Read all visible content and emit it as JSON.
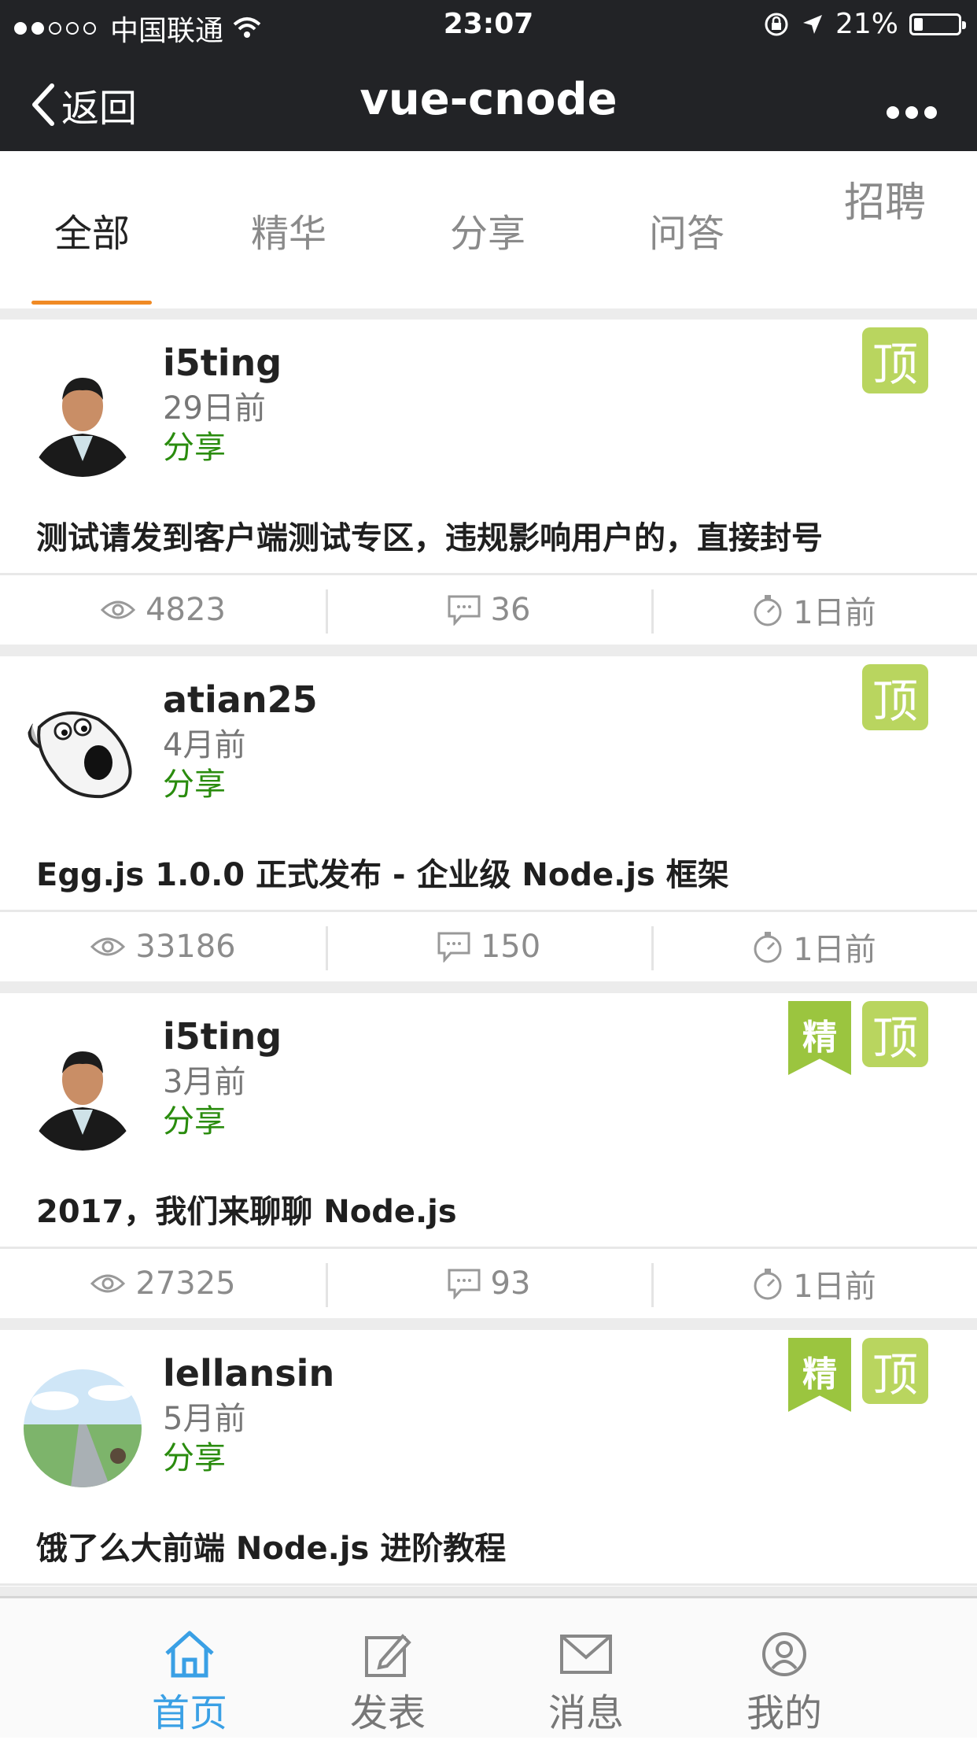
{
  "status_bar": {
    "carrier": "中国联通",
    "time": "23:07",
    "battery": "21%",
    "battery_level": 0.21
  },
  "nav": {
    "back_label": "返回",
    "title": "vue-cnode"
  },
  "tabs": [
    {
      "label": "全部"
    },
    {
      "label": "精华"
    },
    {
      "label": "分享"
    },
    {
      "label": "问答"
    },
    {
      "label": "招聘"
    }
  ],
  "posts": [
    {
      "author": "i5ting",
      "time": "29日前",
      "tab": "分享",
      "top_label": "顶",
      "good_label": "",
      "title": "测试请发到客户端测试专区，违规影响用户的，直接封号",
      "views": "4823",
      "replies": "36",
      "last_reply": "1日前"
    },
    {
      "author": "atian25",
      "time": "4月前",
      "tab": "分享",
      "top_label": "顶",
      "good_label": "",
      "title": "Egg.js 1.0.0 正式发布 - 企业级 Node.js 框架",
      "views": "33186",
      "replies": "150",
      "last_reply": "1日前"
    },
    {
      "author": "i5ting",
      "time": "3月前",
      "tab": "分享",
      "top_label": "顶",
      "good_label": "精",
      "title": "2017，我们来聊聊 Node.js",
      "views": "27325",
      "replies": "93",
      "last_reply": "1日前"
    },
    {
      "author": "lellansin",
      "time": "5月前",
      "tab": "分享",
      "top_label": "顶",
      "good_label": "精",
      "title": "饿了么大前端 Node.js 进阶教程",
      "views": "",
      "replies": "",
      "last_reply": ""
    }
  ],
  "bottom_tabs": [
    {
      "label": "首页",
      "icon": "home-icon"
    },
    {
      "label": "发表",
      "icon": "edit-icon"
    },
    {
      "label": "消息",
      "icon": "mail-icon"
    },
    {
      "label": "我的",
      "icon": "user-icon"
    }
  ],
  "colors": {
    "nav_bg": "#222326",
    "tab_indicator": "#f08a24",
    "tag_green": "#2a8c0e",
    "badge_green": "#b9d55f",
    "active_blue": "#3aa0e5"
  }
}
